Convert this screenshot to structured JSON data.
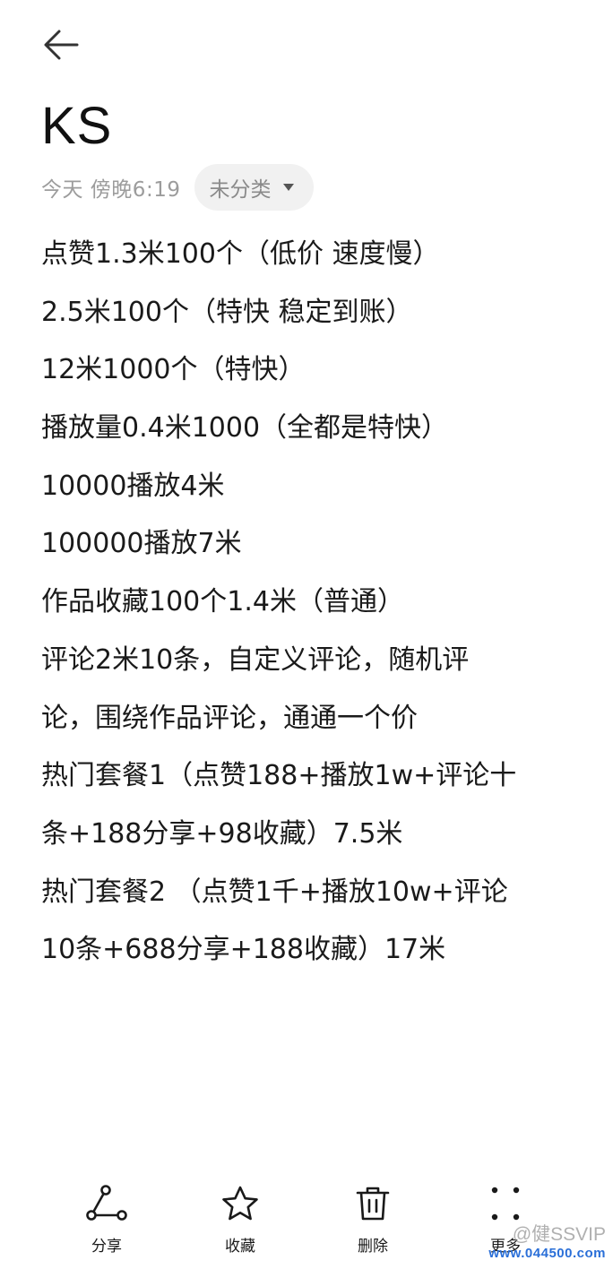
{
  "header": {
    "back_icon": "arrow-left-icon"
  },
  "note": {
    "title": "KS",
    "timestamp": "今天 傍晚6:19",
    "category": "未分类",
    "lines": [
      "点赞1.3米100个（低价 速度慢）",
      "2.5米100个（特快 稳定到账）",
      "12米1000个（特快）",
      "播放量0.4米1000（全都是特快）",
      "10000播放4米",
      "100000播放7米",
      "作品收藏100个1.4米（普通）",
      "评论2米10条，自定义评论，随机评",
      "论，围绕作品评论，通通一个价",
      "热门套餐1（点赞188+播放1w+评论十",
      "条+188分享+98收藏）7.5米",
      "热门套餐2 （点赞1千+播放10w+评论",
      "10条+688分享+188收藏）17米"
    ]
  },
  "toolbar": {
    "share": {
      "label": "分享",
      "icon": "share-icon"
    },
    "favorite": {
      "label": "收藏",
      "icon": "star-icon"
    },
    "delete": {
      "label": "删除",
      "icon": "trash-icon"
    },
    "more": {
      "label": "更多",
      "icon": "more-dots-icon"
    }
  },
  "watermark": {
    "handle": "@健SSVIP",
    "site": "www.044500.com"
  }
}
